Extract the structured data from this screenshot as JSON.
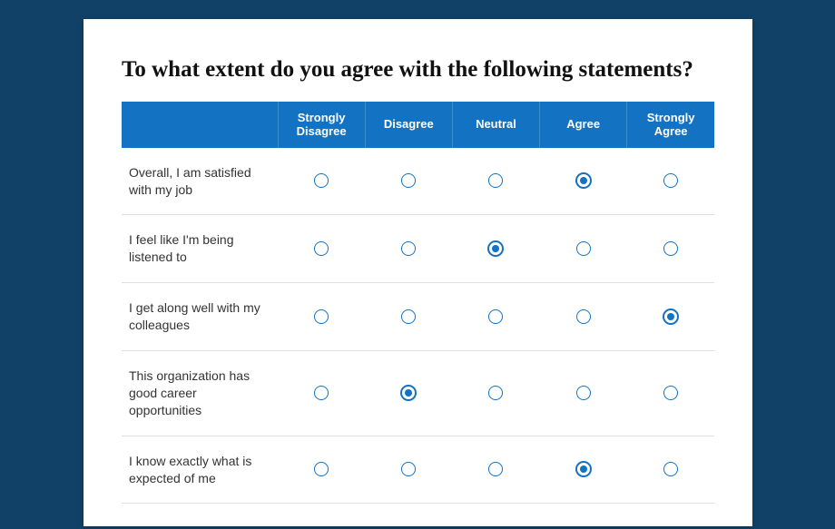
{
  "question": "To what extent do you agree with the following statements?",
  "columns": [
    "Strongly Disagree",
    "Disagree",
    "Neutral",
    "Agree",
    "Strongly Agree"
  ],
  "rows": [
    {
      "label": "Overall, I am satisfied with my job",
      "selected": 3
    },
    {
      "label": "I feel like I'm being listened to",
      "selected": 2
    },
    {
      "label": "I get along well with my colleagues",
      "selected": 4
    },
    {
      "label": "This organization has good career opportunities",
      "selected": 1
    },
    {
      "label": "I know exactly what is expected of me",
      "selected": 3
    }
  ]
}
